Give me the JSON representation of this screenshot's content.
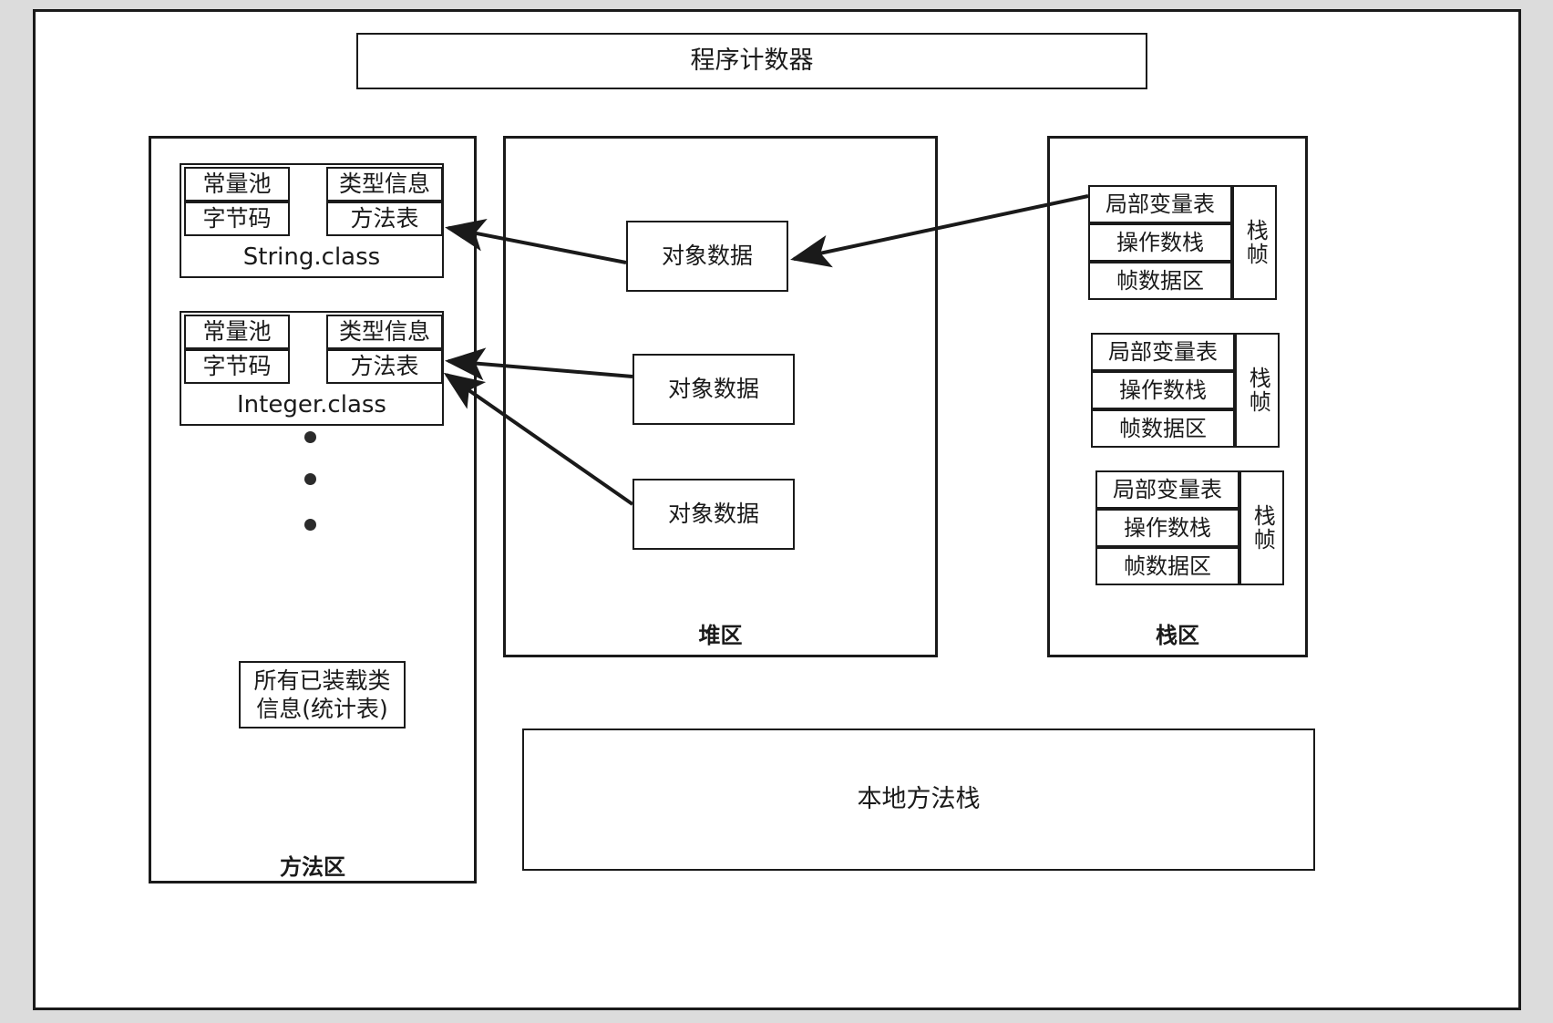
{
  "diagram": {
    "title_box": {
      "label": "程序计数器"
    },
    "method_area": {
      "region_label": "方法区",
      "classes": [
        {
          "name": "String.class",
          "left_cells": [
            "常量池",
            "字节码"
          ],
          "right_cells": [
            "类型信息",
            "方法表"
          ]
        },
        {
          "name": "Integer.class",
          "left_cells": [
            "常量池",
            "字节码"
          ],
          "right_cells": [
            "类型信息",
            "方法表"
          ]
        }
      ],
      "ellipsis_dots": 3,
      "loaded_classes_box": {
        "line1": "所有已装载类",
        "line2": "信息(统计表)"
      }
    },
    "heap_area": {
      "region_label": "堆区",
      "objects": [
        {
          "label": "对象数据"
        },
        {
          "label": "对象数据"
        },
        {
          "label": "对象数据"
        }
      ]
    },
    "stack_area": {
      "region_label": "栈区",
      "frames": [
        {
          "rows": [
            "局部变量表",
            "操作数栈",
            "帧数据区"
          ],
          "side_label": "栈帧"
        },
        {
          "rows": [
            "局部变量表",
            "操作数栈",
            "帧数据区"
          ],
          "side_label": "栈帧"
        },
        {
          "rows": [
            "局部变量表",
            "操作数栈",
            "帧数据区"
          ],
          "side_label": "栈帧"
        }
      ]
    },
    "native_stack_box": {
      "label": "本地方法栈"
    },
    "colors": {
      "page_background": "#dcdcdc",
      "canvas_background": "#ffffff",
      "stroke": "#1a1a1a",
      "dot": "#2b2b2b"
    }
  }
}
